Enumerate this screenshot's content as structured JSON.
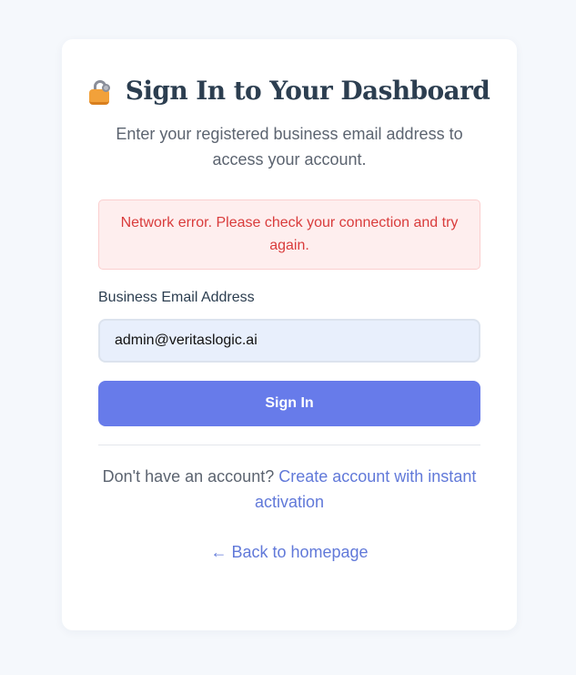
{
  "header": {
    "icon": "lock-icon",
    "title": "Sign In to Your Dashboard",
    "subtitle": "Enter your registered business email address to access your account."
  },
  "error": {
    "message": "Network error. Please check your connection and try again."
  },
  "form": {
    "email_label": "Business Email Address",
    "email_value": "admin@veritaslogic.ai",
    "submit_label": "Sign In"
  },
  "footer": {
    "prompt": "Don't have an account?",
    "create_link": "Create account with instant activation",
    "back_link": "← Back to homepage"
  },
  "colors": {
    "accent": "#677bea",
    "link": "#6179d9",
    "error_text": "#d93c3c",
    "error_bg": "#feeeee"
  }
}
